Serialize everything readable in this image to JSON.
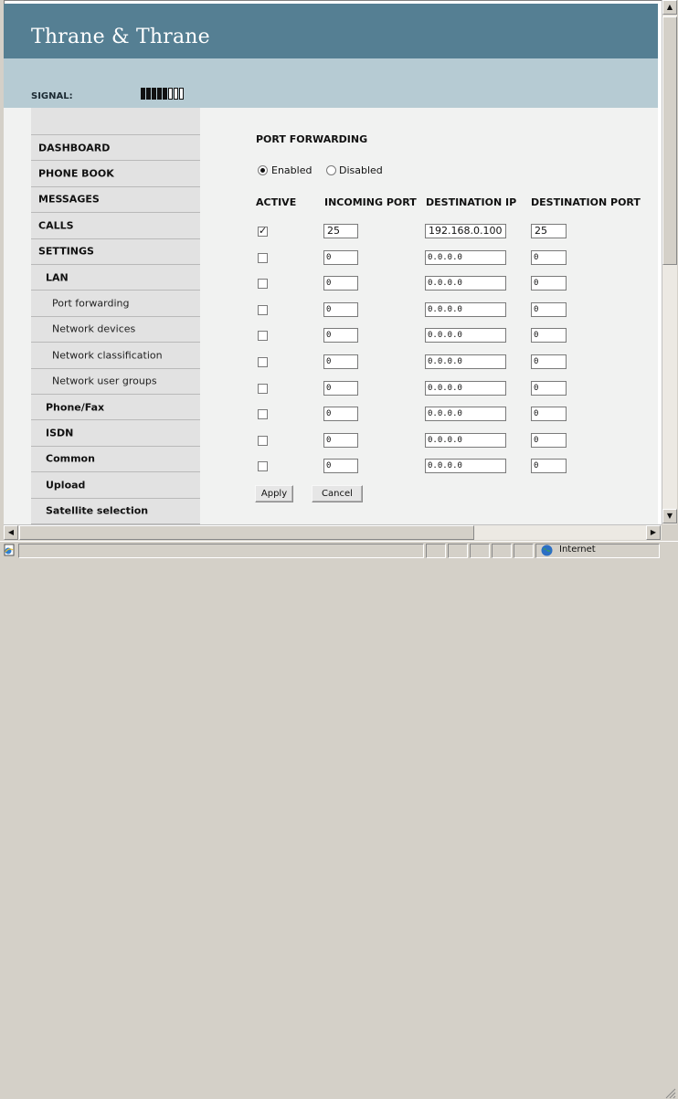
{
  "app": {
    "brand": "Thrane & Thrane"
  },
  "signal": {
    "label": "SIGNAL:",
    "level": 5,
    "max": 8
  },
  "nav": {
    "items": [
      {
        "label": "DASHBOARD",
        "level": 1
      },
      {
        "label": "PHONE BOOK",
        "level": 1
      },
      {
        "label": "MESSAGES",
        "level": 1
      },
      {
        "label": "CALLS",
        "level": 1
      },
      {
        "label": "SETTINGS",
        "level": 1
      },
      {
        "label": "LAN",
        "level": 2
      },
      {
        "label": "Port forwarding",
        "level": 3
      },
      {
        "label": "Network devices",
        "level": 3
      },
      {
        "label": "Network classification",
        "level": 3
      },
      {
        "label": "Network user groups",
        "level": 3
      },
      {
        "label": "Phone/Fax",
        "level": 2
      },
      {
        "label": "ISDN",
        "level": 2
      },
      {
        "label": "Common",
        "level": 2
      },
      {
        "label": "Upload",
        "level": 2
      },
      {
        "label": "Satellite selection",
        "level": 2
      }
    ]
  },
  "port_forwarding": {
    "title": "PORT FORWARDING",
    "enabled_label": "Enabled",
    "disabled_label": "Disabled",
    "enabled": true,
    "columns": [
      "ACTIVE",
      "INCOMING PORT",
      "DESTINATION IP",
      "DESTINATION PORT"
    ],
    "rows": [
      {
        "active": true,
        "incoming": "25",
        "dest_ip": "192.168.0.100",
        "dest_port": "25"
      },
      {
        "active": false,
        "incoming": "0",
        "dest_ip": "0.0.0.0",
        "dest_port": "0"
      },
      {
        "active": false,
        "incoming": "0",
        "dest_ip": "0.0.0.0",
        "dest_port": "0"
      },
      {
        "active": false,
        "incoming": "0",
        "dest_ip": "0.0.0.0",
        "dest_port": "0"
      },
      {
        "active": false,
        "incoming": "0",
        "dest_ip": "0.0.0.0",
        "dest_port": "0"
      },
      {
        "active": false,
        "incoming": "0",
        "dest_ip": "0.0.0.0",
        "dest_port": "0"
      },
      {
        "active": false,
        "incoming": "0",
        "dest_ip": "0.0.0.0",
        "dest_port": "0"
      },
      {
        "active": false,
        "incoming": "0",
        "dest_ip": "0.0.0.0",
        "dest_port": "0"
      },
      {
        "active": false,
        "incoming": "0",
        "dest_ip": "0.0.0.0",
        "dest_port": "0"
      },
      {
        "active": false,
        "incoming": "0",
        "dest_ip": "0.0.0.0",
        "dest_port": "0"
      }
    ],
    "apply_label": "Apply",
    "cancel_label": "Cancel"
  },
  "status": {
    "zone": "Internet"
  },
  "colors": {
    "header": "#557f93",
    "subheader": "#b6cbd3",
    "sidebar": "#e2e2e2",
    "content": "#f1f2f1"
  },
  "icons": {
    "page": "ie-page-icon",
    "zone": "globe-icon",
    "up": "arrow-up-icon",
    "down": "arrow-down-icon",
    "left": "arrow-left-icon",
    "right": "arrow-right-icon"
  }
}
